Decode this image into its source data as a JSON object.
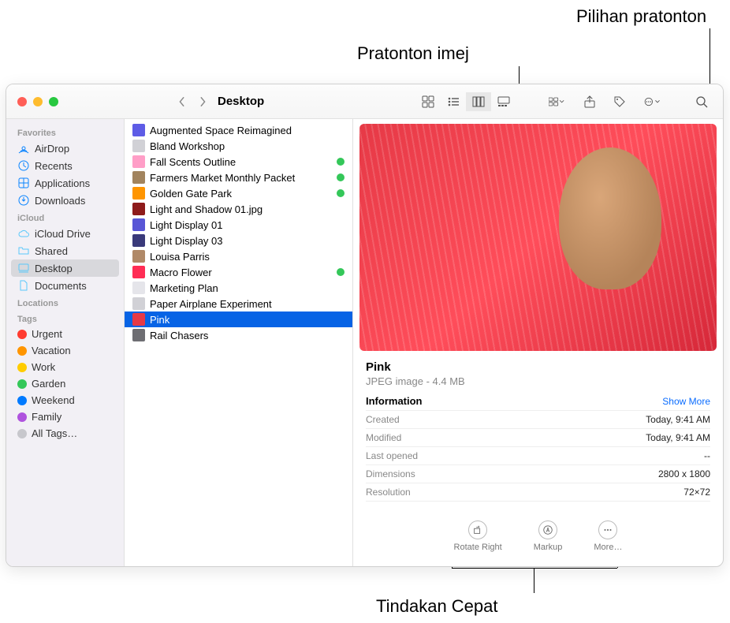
{
  "callouts": {
    "preview_image": "Pratonton imej",
    "preview_options": "Pilihan pratonton",
    "quick_actions": "Tindakan Cepat"
  },
  "window": {
    "title": "Desktop"
  },
  "sidebar": {
    "sections": {
      "favorites": "Favorites",
      "icloud": "iCloud",
      "locations": "Locations",
      "tags": "Tags"
    },
    "favorites": [
      {
        "label": "AirDrop",
        "icon": "airdrop"
      },
      {
        "label": "Recents",
        "icon": "clock"
      },
      {
        "label": "Applications",
        "icon": "apps"
      },
      {
        "label": "Downloads",
        "icon": "download"
      }
    ],
    "icloud": [
      {
        "label": "iCloud Drive",
        "icon": "cloud"
      },
      {
        "label": "Shared",
        "icon": "folder"
      },
      {
        "label": "Desktop",
        "icon": "desktop",
        "selected": true
      },
      {
        "label": "Documents",
        "icon": "doc"
      }
    ],
    "tags": [
      {
        "label": "Urgent",
        "color": "#ff3b30"
      },
      {
        "label": "Vacation",
        "color": "#ff9500"
      },
      {
        "label": "Work",
        "color": "#ffcc00"
      },
      {
        "label": "Garden",
        "color": "#34c759"
      },
      {
        "label": "Weekend",
        "color": "#007aff"
      },
      {
        "label": "Family",
        "color": "#af52de"
      },
      {
        "label": "All Tags…",
        "color": "#c7c7cc"
      }
    ]
  },
  "files": [
    {
      "label": "Augmented Space Reimagined",
      "color": "#5e5ce6"
    },
    {
      "label": "Bland Workshop",
      "color": "#d1d1d6"
    },
    {
      "label": "Fall Scents Outline",
      "color": "#ff9ec7",
      "tagged": true
    },
    {
      "label": "Farmers Market Monthly Packet",
      "color": "#a2845e",
      "tagged": true
    },
    {
      "label": "Golden Gate Park",
      "color": "#ff9500",
      "tagged": true
    },
    {
      "label": "Light and Shadow 01.jpg",
      "color": "#8e1b1b"
    },
    {
      "label": "Light Display 01",
      "color": "#5856d6"
    },
    {
      "label": "Light Display 03",
      "color": "#3a3a7a"
    },
    {
      "label": "Louisa Parris",
      "color": "#b08968"
    },
    {
      "label": "Macro Flower",
      "color": "#ff2d55",
      "tagged": true
    },
    {
      "label": "Marketing Plan",
      "color": "#e5e5ea"
    },
    {
      "label": "Paper Airplane Experiment",
      "color": "#d1d1d6"
    },
    {
      "label": "Pink",
      "color": "#e63946",
      "selected": true
    },
    {
      "label": "Rail Chasers",
      "color": "#6e6e73"
    }
  ],
  "preview": {
    "name": "Pink",
    "type": "JPEG image - 4.4 MB",
    "info_label": "Information",
    "show_more": "Show More",
    "rows": [
      {
        "k": "Created",
        "v": "Today, 9:41 AM"
      },
      {
        "k": "Modified",
        "v": "Today, 9:41 AM"
      },
      {
        "k": "Last opened",
        "v": "--"
      },
      {
        "k": "Dimensions",
        "v": "2800 x 1800"
      },
      {
        "k": "Resolution",
        "v": "72×72"
      }
    ],
    "actions": [
      {
        "label": "Rotate Right"
      },
      {
        "label": "Markup"
      },
      {
        "label": "More…"
      }
    ]
  }
}
